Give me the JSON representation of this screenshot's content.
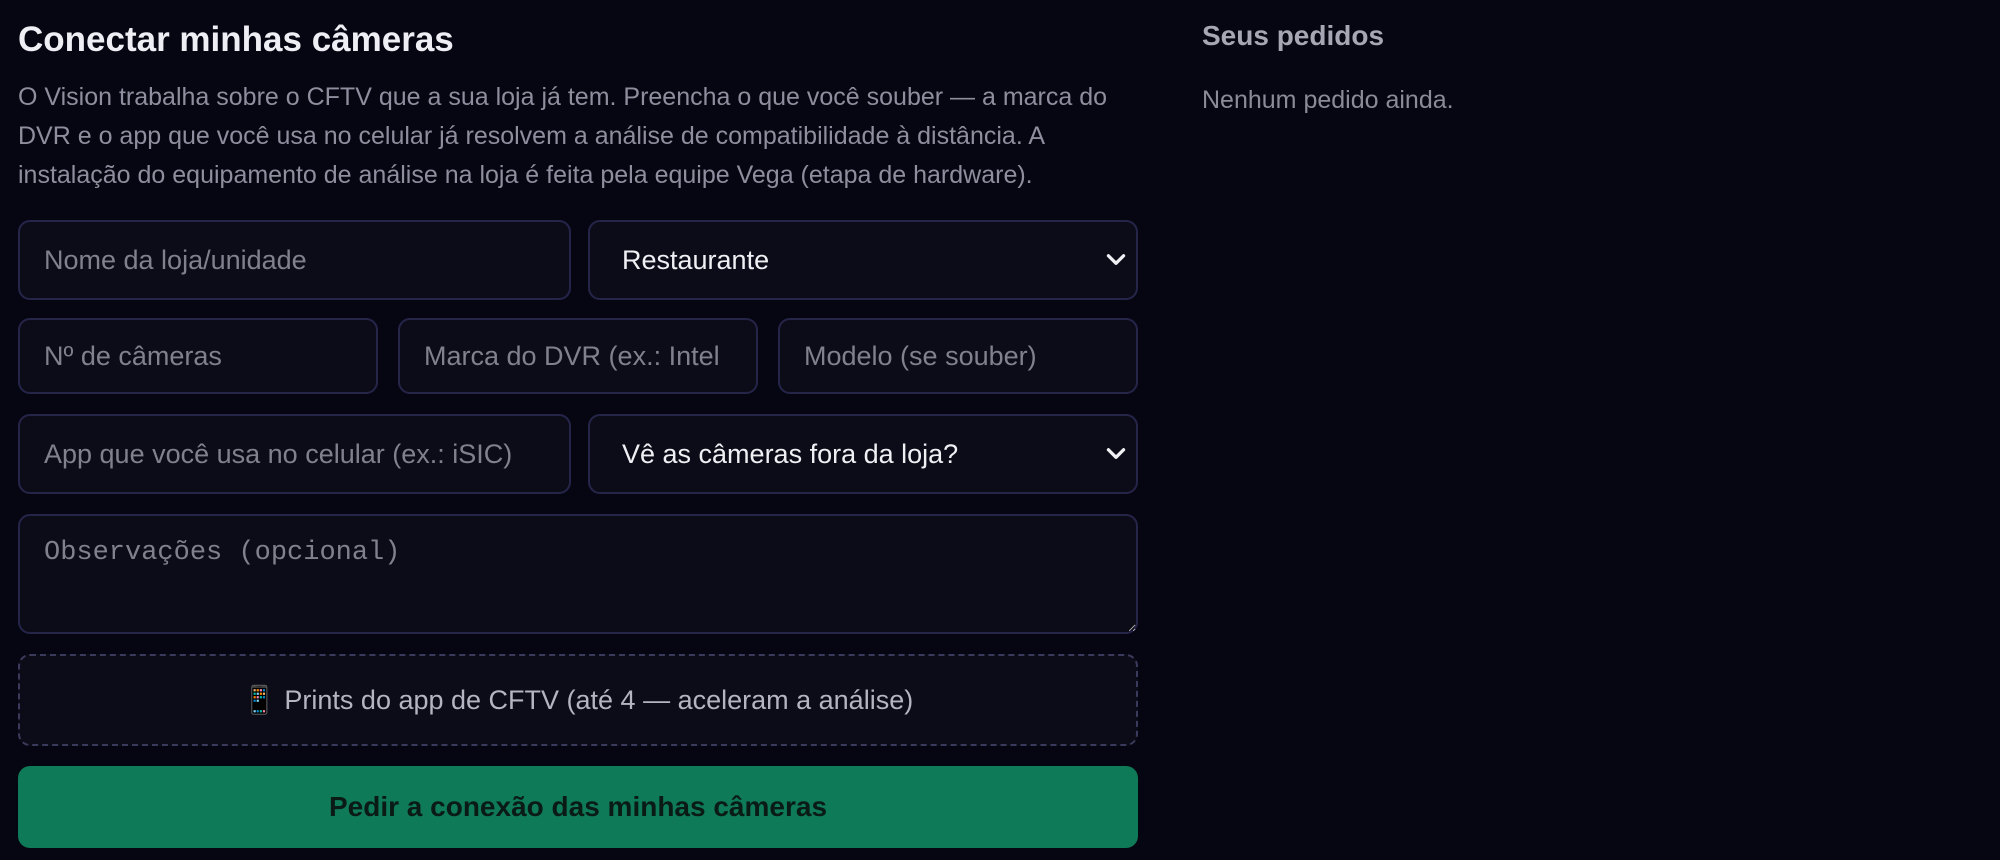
{
  "form": {
    "title": "Conectar minhas câmeras",
    "intro": "O Vision trabalha sobre o CFTV que a sua loja já tem. Preencha o que você souber — a marca do DVR e o app que você usa no celular já resolvem a análise de compatibilidade à distância. A instalação do equipamento de análise na loja é feita pela equipe Vega (etapa de hardware).",
    "store_name": {
      "value": "",
      "placeholder": "Nome da loja/unidade"
    },
    "segment_select": {
      "selected": "Restaurante"
    },
    "camera_count": {
      "value": "",
      "placeholder": "Nº de câmeras"
    },
    "dvr_brand": {
      "value": "",
      "placeholder": "Marca do DVR (ex.: Intel"
    },
    "dvr_model": {
      "value": "",
      "placeholder": "Modelo (se souber)"
    },
    "mobile_app": {
      "value": "",
      "placeholder": "App que você usa no celular (ex.: iSIC)"
    },
    "remote_view_select": {
      "selected": "Vê as câmeras fora da loja?"
    },
    "notes": {
      "value": "",
      "placeholder": "Observações (opcional)"
    },
    "upload_icon": "📱",
    "upload_label": "Prints do app de CFTV (até 4 — aceleram a análise)",
    "submit_label": "Pedir a conexão das minhas câmeras"
  },
  "orders": {
    "title": "Seus pedidos",
    "empty_text": "Nenhum pedido ainda."
  },
  "icons": {
    "select_chevron": "chevron-down-icon",
    "upload": "phone-icon"
  },
  "colors": {
    "background": "#060612",
    "field_background": "#0c0c18",
    "field_border": "#25254a",
    "accent_button": "#0f7a57",
    "muted_text": "#8e8e9e"
  }
}
